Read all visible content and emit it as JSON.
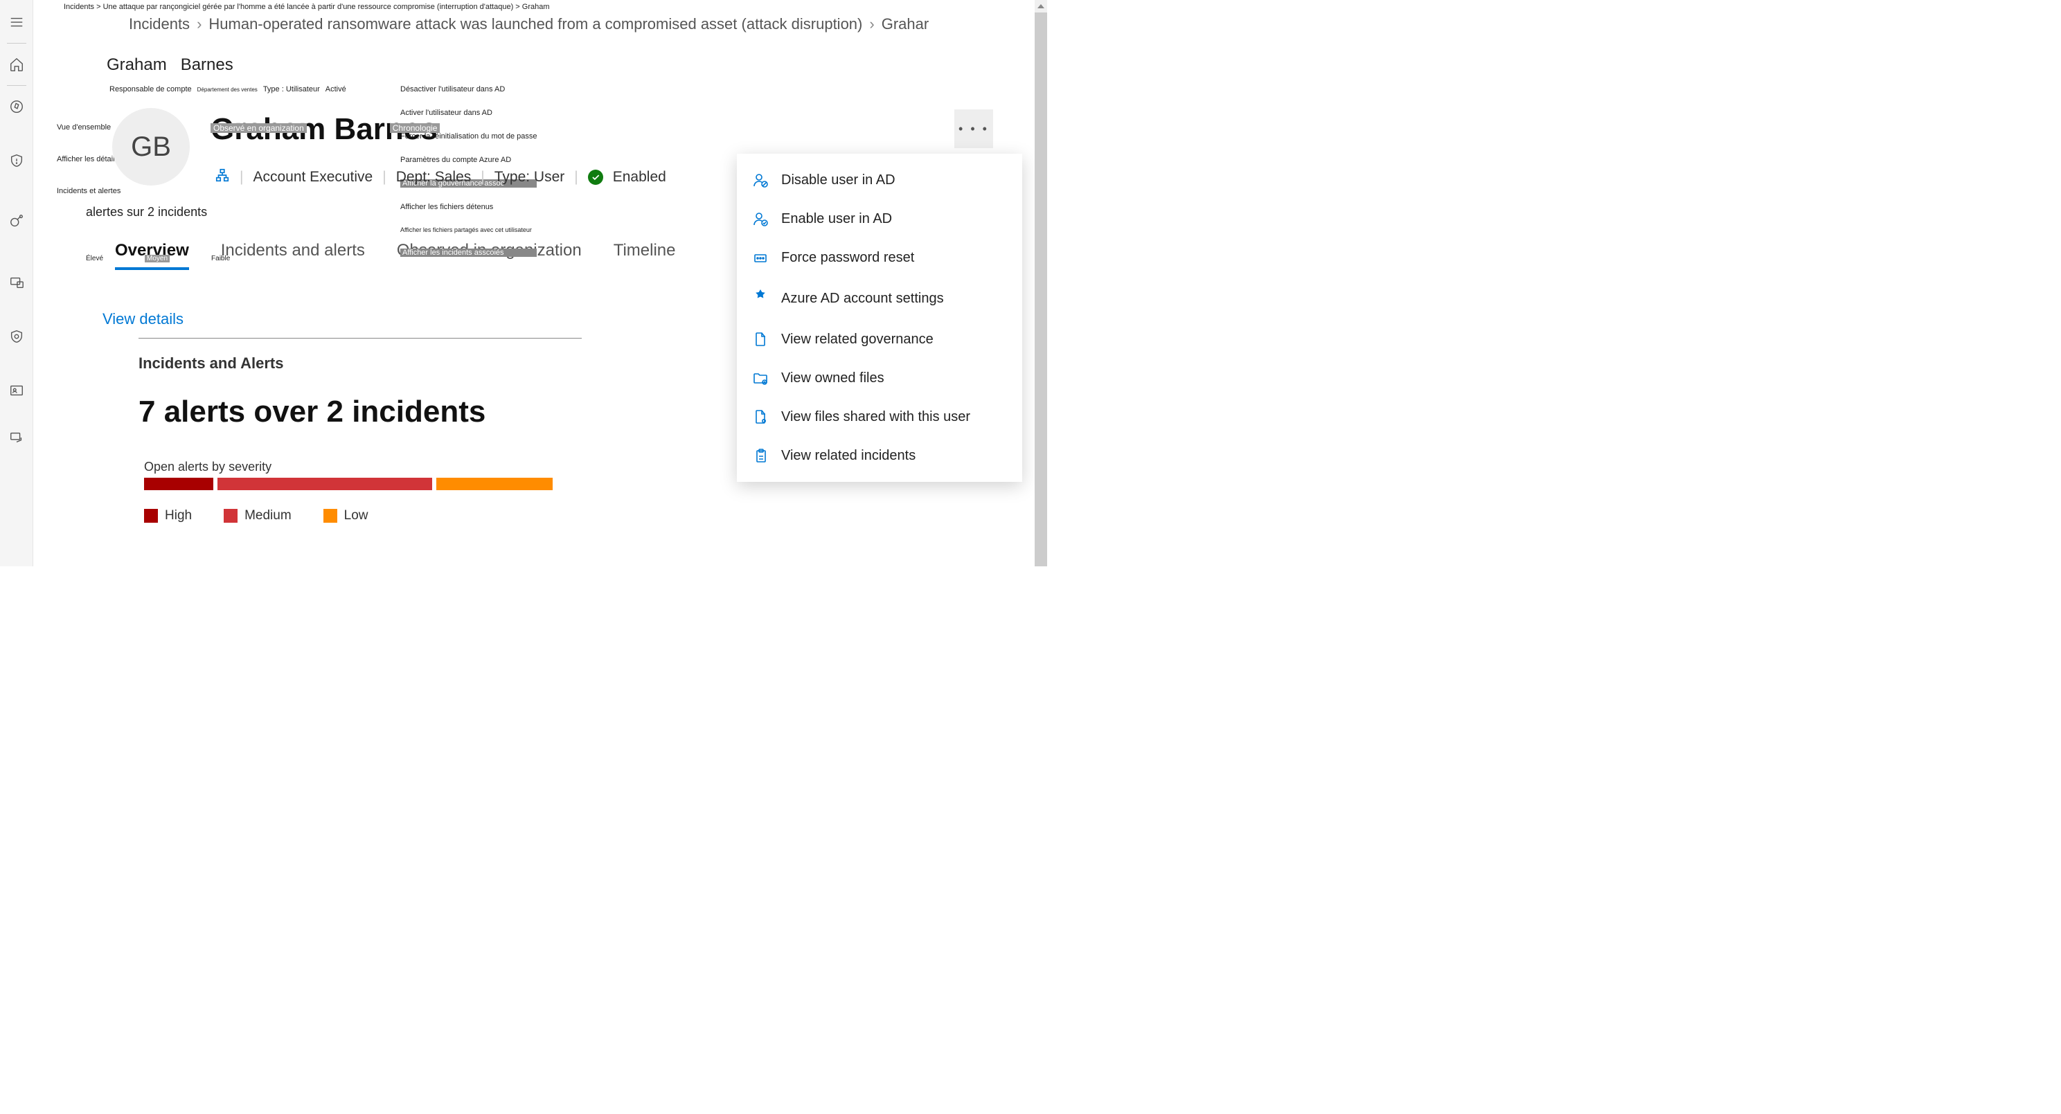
{
  "breadcrumb_raw_fr": "Incidents >   Une attaque par rançongiciel gérée par l'homme a été lancée à partir d'une ressource compromise (interruption d'attaque) >    Graham",
  "breadcrumb": {
    "root": "Incidents",
    "incident": "Human-operated ransomware attack was launched from a compromised asset (attack disruption)",
    "entity": "Grahar"
  },
  "user": {
    "first": "Graham",
    "last": "Barnes",
    "full": "Graham Barnes",
    "initials": "GB",
    "role": "Account Executive",
    "dept": "Dept: Sales",
    "type": "Type: User",
    "status": "Enabled"
  },
  "micro_meta": {
    "role_fr": "Responsable de compte",
    "dept_fr": "Département des ventes",
    "type_fr": "Type : Utilisateur",
    "status_fr": "Activé"
  },
  "fr_actions": {
    "disable": "Désactiver l'utilisateur dans AD",
    "enable": "Activer l'utilisateur dans AD",
    "reset": "Forcer la réinitialisation du mot de passe",
    "azure": "Paramètres du compte Azure AD",
    "gov": "Afficher la gouvernance assoc",
    "owned": "Afficher les fichiers détenus",
    "shared": "Afficher les fichiers partagés avec cet utilisateur",
    "incidents": "Afficher les incidents asscoiés"
  },
  "left_labels": {
    "overview_fr": "Vue d'ensemble",
    "ia_fr": "Incidents et alertes",
    "details_fr": "Afficher les détails",
    "ia2_fr": "Incidents et alertes"
  },
  "chips": {
    "observed_fr": "Observé en organization",
    "timeline_fr": "Chronologie"
  },
  "alert_summary_fr": "alertes sur 2 incidents",
  "tabs": {
    "overview": "Overview",
    "ia": "Incidents and alerts",
    "observed": "Observed in organization",
    "timeline": "Timeline"
  },
  "sev_labels_fr": {
    "high": "Élevé",
    "med": "Moyen",
    "low": "Faible"
  },
  "view_details": "View details",
  "card": {
    "title": "Incidents and Alerts",
    "headline": "7 alerts over 2 incidents",
    "sev_heading": "Open alerts by severity",
    "legend": {
      "high": "High",
      "med": "Medium",
      "low": "Low"
    }
  },
  "chart_data": {
    "type": "bar",
    "orientation": "stacked-horizontal",
    "title": "Open alerts by severity",
    "series": [
      {
        "name": "High",
        "color": "#a80000",
        "value": 1
      },
      {
        "name": "Medium",
        "color": "#d13438",
        "value": 4
      },
      {
        "name": "Low",
        "color": "#ff8c00",
        "value": 2
      }
    ],
    "total_alerts": 7,
    "total_incidents": 2
  },
  "dropdown": [
    {
      "id": "disable-user",
      "label": "Disable user in AD"
    },
    {
      "id": "enable-user",
      "label": "Enable user in AD"
    },
    {
      "id": "force-reset",
      "label": "Force password reset"
    },
    {
      "id": "azure-settings",
      "label": "Azure AD account settings"
    },
    {
      "id": "view-gov",
      "label": "View related governance"
    },
    {
      "id": "view-owned",
      "label": "View owned files"
    },
    {
      "id": "view-shared",
      "label": "View files shared with this user"
    },
    {
      "id": "view-incidents",
      "label": "View related incidents"
    }
  ]
}
